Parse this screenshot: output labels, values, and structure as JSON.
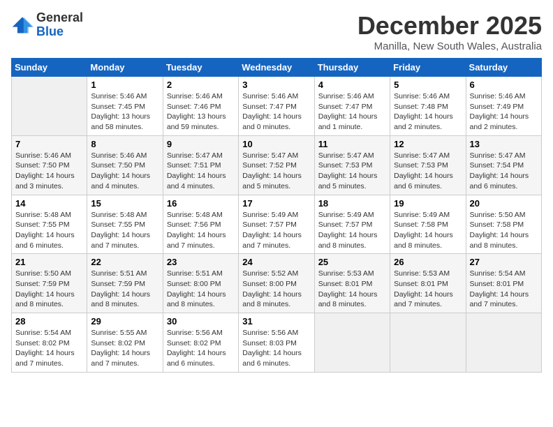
{
  "header": {
    "logo_general": "General",
    "logo_blue": "Blue",
    "title": "December 2025",
    "subtitle": "Manilla, New South Wales, Australia"
  },
  "weekdays": [
    "Sunday",
    "Monday",
    "Tuesday",
    "Wednesday",
    "Thursday",
    "Friday",
    "Saturday"
  ],
  "weeks": [
    [
      {
        "day": "",
        "info": ""
      },
      {
        "day": "1",
        "info": "Sunrise: 5:46 AM\nSunset: 7:45 PM\nDaylight: 13 hours\nand 58 minutes."
      },
      {
        "day": "2",
        "info": "Sunrise: 5:46 AM\nSunset: 7:46 PM\nDaylight: 13 hours\nand 59 minutes."
      },
      {
        "day": "3",
        "info": "Sunrise: 5:46 AM\nSunset: 7:47 PM\nDaylight: 14 hours\nand 0 minutes."
      },
      {
        "day": "4",
        "info": "Sunrise: 5:46 AM\nSunset: 7:47 PM\nDaylight: 14 hours\nand 1 minute."
      },
      {
        "day": "5",
        "info": "Sunrise: 5:46 AM\nSunset: 7:48 PM\nDaylight: 14 hours\nand 2 minutes."
      },
      {
        "day": "6",
        "info": "Sunrise: 5:46 AM\nSunset: 7:49 PM\nDaylight: 14 hours\nand 2 minutes."
      }
    ],
    [
      {
        "day": "7",
        "info": "Sunrise: 5:46 AM\nSunset: 7:50 PM\nDaylight: 14 hours\nand 3 minutes."
      },
      {
        "day": "8",
        "info": "Sunrise: 5:46 AM\nSunset: 7:50 PM\nDaylight: 14 hours\nand 4 minutes."
      },
      {
        "day": "9",
        "info": "Sunrise: 5:47 AM\nSunset: 7:51 PM\nDaylight: 14 hours\nand 4 minutes."
      },
      {
        "day": "10",
        "info": "Sunrise: 5:47 AM\nSunset: 7:52 PM\nDaylight: 14 hours\nand 5 minutes."
      },
      {
        "day": "11",
        "info": "Sunrise: 5:47 AM\nSunset: 7:53 PM\nDaylight: 14 hours\nand 5 minutes."
      },
      {
        "day": "12",
        "info": "Sunrise: 5:47 AM\nSunset: 7:53 PM\nDaylight: 14 hours\nand 6 minutes."
      },
      {
        "day": "13",
        "info": "Sunrise: 5:47 AM\nSunset: 7:54 PM\nDaylight: 14 hours\nand 6 minutes."
      }
    ],
    [
      {
        "day": "14",
        "info": "Sunrise: 5:48 AM\nSunset: 7:55 PM\nDaylight: 14 hours\nand 6 minutes."
      },
      {
        "day": "15",
        "info": "Sunrise: 5:48 AM\nSunset: 7:55 PM\nDaylight: 14 hours\nand 7 minutes."
      },
      {
        "day": "16",
        "info": "Sunrise: 5:48 AM\nSunset: 7:56 PM\nDaylight: 14 hours\nand 7 minutes."
      },
      {
        "day": "17",
        "info": "Sunrise: 5:49 AM\nSunset: 7:57 PM\nDaylight: 14 hours\nand 7 minutes."
      },
      {
        "day": "18",
        "info": "Sunrise: 5:49 AM\nSunset: 7:57 PM\nDaylight: 14 hours\nand 8 minutes."
      },
      {
        "day": "19",
        "info": "Sunrise: 5:49 AM\nSunset: 7:58 PM\nDaylight: 14 hours\nand 8 minutes."
      },
      {
        "day": "20",
        "info": "Sunrise: 5:50 AM\nSunset: 7:58 PM\nDaylight: 14 hours\nand 8 minutes."
      }
    ],
    [
      {
        "day": "21",
        "info": "Sunrise: 5:50 AM\nSunset: 7:59 PM\nDaylight: 14 hours\nand 8 minutes."
      },
      {
        "day": "22",
        "info": "Sunrise: 5:51 AM\nSunset: 7:59 PM\nDaylight: 14 hours\nand 8 minutes."
      },
      {
        "day": "23",
        "info": "Sunrise: 5:51 AM\nSunset: 8:00 PM\nDaylight: 14 hours\nand 8 minutes."
      },
      {
        "day": "24",
        "info": "Sunrise: 5:52 AM\nSunset: 8:00 PM\nDaylight: 14 hours\nand 8 minutes."
      },
      {
        "day": "25",
        "info": "Sunrise: 5:53 AM\nSunset: 8:01 PM\nDaylight: 14 hours\nand 8 minutes."
      },
      {
        "day": "26",
        "info": "Sunrise: 5:53 AM\nSunset: 8:01 PM\nDaylight: 14 hours\nand 7 minutes."
      },
      {
        "day": "27",
        "info": "Sunrise: 5:54 AM\nSunset: 8:01 PM\nDaylight: 14 hours\nand 7 minutes."
      }
    ],
    [
      {
        "day": "28",
        "info": "Sunrise: 5:54 AM\nSunset: 8:02 PM\nDaylight: 14 hours\nand 7 minutes."
      },
      {
        "day": "29",
        "info": "Sunrise: 5:55 AM\nSunset: 8:02 PM\nDaylight: 14 hours\nand 7 minutes."
      },
      {
        "day": "30",
        "info": "Sunrise: 5:56 AM\nSunset: 8:02 PM\nDaylight: 14 hours\nand 6 minutes."
      },
      {
        "day": "31",
        "info": "Sunrise: 5:56 AM\nSunset: 8:03 PM\nDaylight: 14 hours\nand 6 minutes."
      },
      {
        "day": "",
        "info": ""
      },
      {
        "day": "",
        "info": ""
      },
      {
        "day": "",
        "info": ""
      }
    ]
  ]
}
